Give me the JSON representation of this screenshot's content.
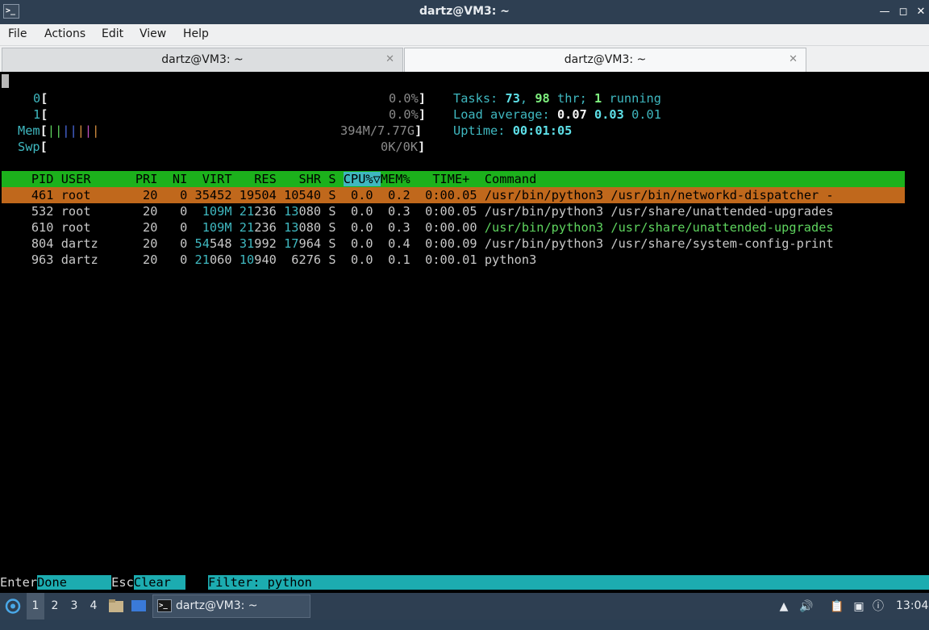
{
  "window": {
    "title": "dartz@VM3: ~"
  },
  "menu": [
    "File",
    "Actions",
    "Edit",
    "View",
    "Help"
  ],
  "tabs": [
    {
      "label": "dartz@VM3: ~",
      "active": false
    },
    {
      "label": "dartz@VM3: ~",
      "active": true
    }
  ],
  "htop": {
    "cpu0": {
      "label": "0",
      "value": "0.0%"
    },
    "cpu1": {
      "label": "1",
      "value": "0.0%"
    },
    "mem": {
      "label": "Mem",
      "value": "394M/7.77G"
    },
    "swp": {
      "label": "Swp",
      "value": "0K/0K"
    },
    "tasks": {
      "label": "Tasks:",
      "count": "73",
      "thr": "98",
      "thr_label": "thr;",
      "running": "1",
      "running_label": "running"
    },
    "load": {
      "label": "Load average:",
      "v1": "0.07",
      "v2": "0.03",
      "v3": "0.01"
    },
    "uptime": {
      "label": "Uptime:",
      "value": "00:01:05"
    },
    "columns": [
      "PID",
      "USER",
      "PRI",
      "NI",
      "VIRT",
      "RES",
      "SHR",
      "S",
      "CPU%▽",
      "MEM%",
      "TIME+",
      "Command"
    ],
    "processes": [
      {
        "pid": "461",
        "user": "root",
        "pri": "20",
        "ni": "0",
        "virt": "35452",
        "res": "19504",
        "shr": "10540",
        "s": "S",
        "cpu": "0.0",
        "mem": "0.2",
        "time": "0:00.05",
        "cmd": "/usr/bin/python3 /usr/bin/networkd-dispatcher -"
      },
      {
        "pid": "532",
        "user": "root",
        "pri": "20",
        "ni": "0",
        "virt": "109M",
        "res_hi": "21",
        "res_lo": "236",
        "shr_hi": "13",
        "shr_lo": "080",
        "s": "S",
        "cpu": "0.0",
        "mem": "0.3",
        "time": "0:00.05",
        "cmd": "/usr/bin/python3 /usr/share/unattended-upgrades"
      },
      {
        "pid": "610",
        "user": "root",
        "pri": "20",
        "ni": "0",
        "virt": "109M",
        "res_hi": "21",
        "res_lo": "236",
        "shr_hi": "13",
        "shr_lo": "080",
        "s": "S",
        "cpu": "0.0",
        "mem": "0.3",
        "time": "0:00.00",
        "cmd": "/usr/bin/python3 /usr/share/unattended-upgrades"
      },
      {
        "pid": "804",
        "user": "dartz",
        "pri": "20",
        "ni": "0",
        "virt_hi": "54",
        "virt_lo": "548",
        "res_hi": "31",
        "res_lo": "992",
        "shr_hi": "17",
        "shr_lo": "964",
        "s": "S",
        "cpu": "0.0",
        "mem": "0.4",
        "time": "0:00.09",
        "cmd": "/usr/bin/python3 /usr/share/system-config-print"
      },
      {
        "pid": "963",
        "user": "dartz",
        "pri": "20",
        "ni": "0",
        "virt_hi": "21",
        "virt_lo": "060",
        "res_hi": "10",
        "res_lo": "940",
        "shr": "6276",
        "s": "S",
        "cpu": "0.0",
        "mem": "0.1",
        "time": "0:00.01",
        "cmd": "python3"
      }
    ],
    "footer": {
      "enter_key": "Enter",
      "enter_label": "Done",
      "esc_key": "Esc",
      "esc_label": "Clear",
      "filter_label": "Filter:",
      "filter_value": "python"
    }
  },
  "taskbar": {
    "workspaces": [
      "1",
      "2",
      "3",
      "4"
    ],
    "task_label": "dartz@VM3: ~",
    "clock": "13:04"
  }
}
